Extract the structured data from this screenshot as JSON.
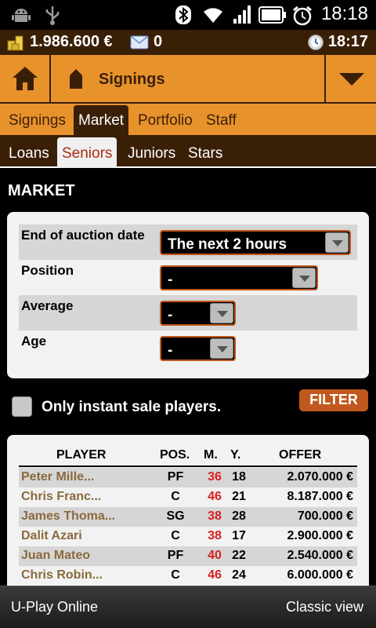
{
  "status_bar": {
    "time": "18:18",
    "icons": [
      "android-debug-icon",
      "usb-icon",
      "bluetooth-icon",
      "wifi-icon",
      "signal-icon",
      "battery-icon",
      "alarm-icon"
    ]
  },
  "money_bar": {
    "money": "1.986.600 €",
    "messages": "0",
    "game_time": "18:17"
  },
  "header": {
    "title": "Signings"
  },
  "primary_tabs": [
    {
      "label": "Signings",
      "active": false
    },
    {
      "label": "Market",
      "active": true
    },
    {
      "label": "Portfolio",
      "active": false
    },
    {
      "label": "Staff",
      "active": false
    }
  ],
  "secondary_tabs": [
    {
      "label": "Loans",
      "active": false
    },
    {
      "label": "Seniors",
      "active": true
    },
    {
      "label": "Juniors",
      "active": false
    },
    {
      "label": "Stars",
      "active": false
    }
  ],
  "market": {
    "title": "MARKET",
    "filters": [
      {
        "label": "End of auction date",
        "value": "The next 2 hours"
      },
      {
        "label": "Position",
        "value": "-"
      },
      {
        "label": "Average",
        "value": "-"
      },
      {
        "label": "Age",
        "value": "-"
      }
    ],
    "instant_label": "Only instant sale players.",
    "filter_button": "FILTER"
  },
  "table": {
    "headers": {
      "player": "PLAYER",
      "pos": "POS.",
      "avg": "M.",
      "age": "Y.",
      "offer": "OFFER"
    },
    "rows": [
      {
        "player": "Peter  Mille...",
        "pos": "PF",
        "avg": "36",
        "age": "18",
        "offer": "2.070.000 €"
      },
      {
        "player": "Chris  Franc...",
        "pos": "C",
        "avg": "46",
        "age": "21",
        "offer": "8.187.000 €"
      },
      {
        "player": "James  Thoma...",
        "pos": "SG",
        "avg": "38",
        "age": "28",
        "offer": "700.000 €"
      },
      {
        "player": "Dalit Azari",
        "pos": "C",
        "avg": "38",
        "age": "17",
        "offer": "2.900.000 €"
      },
      {
        "player": "Juan Mateo",
        "pos": "PF",
        "avg": "40",
        "age": "22",
        "offer": "2.540.000 €"
      },
      {
        "player": "Chris  Robin...",
        "pos": "C",
        "avg": "46",
        "age": "24",
        "offer": "6.000.000 €"
      }
    ]
  },
  "bottom_bar": {
    "left": "U-Play Online",
    "right": "Classic view"
  },
  "colors": {
    "orange": "#e8922c",
    "brown": "#3a1f07",
    "accent": "#c0581f",
    "highlight_red": "#d62020"
  }
}
